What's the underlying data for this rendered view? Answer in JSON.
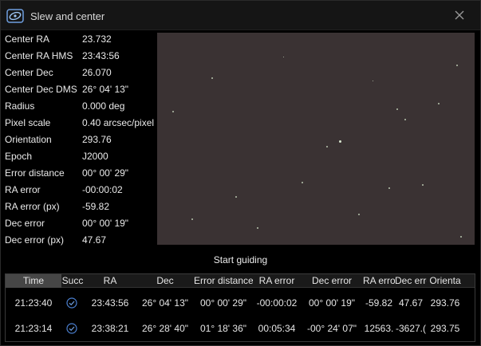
{
  "window": {
    "title": "Slew and center"
  },
  "properties": [
    {
      "key": "Center RA",
      "value": "23.732"
    },
    {
      "key": "Center RA HMS",
      "value": "23:43:56"
    },
    {
      "key": "Center Dec",
      "value": "26.070"
    },
    {
      "key": "Center Dec DMS",
      "value": "26° 04' 13\""
    },
    {
      "key": "Radius",
      "value": "0.000 deg"
    },
    {
      "key": "Pixel scale",
      "value": "0.40 arcsec/pixel"
    },
    {
      "key": "Orientation",
      "value": "293.76"
    },
    {
      "key": "Epoch",
      "value": "J2000"
    },
    {
      "key": "Error distance",
      "value": "00° 00' 29\""
    },
    {
      "key": "RA error",
      "value": "-00:00:02"
    },
    {
      "key": "RA error (px)",
      "value": "-59.82"
    },
    {
      "key": "Dec error",
      "value": "00° 00' 19\""
    },
    {
      "key": "Dec error (px)",
      "value": "47.67"
    }
  ],
  "guide_button": "Start guiding",
  "table": {
    "columns": [
      "Time",
      "Succ",
      "RA",
      "Dec",
      "Error distance",
      "RA error",
      "Dec error",
      "RA erro",
      "Dec erro",
      "Orienta"
    ],
    "rows": [
      {
        "time": "21:23:40",
        "success_icon": "check-circle-icon",
        "ra": "23:43:56",
        "dec": "26° 04' 13\"",
        "error_distance": "00° 00' 29\"",
        "ra_error": "-00:00:02",
        "dec_error": "00° 00' 19\"",
        "ra_error_px": "-59.82",
        "dec_error_px": "47.67",
        "orientation": "293.76"
      },
      {
        "time": "21:23:14",
        "success_icon": "check-circle-icon",
        "ra": "23:38:21",
        "dec": "26° 28' 40\"",
        "error_distance": "01° 18' 36\"",
        "ra_error": "00:05:34",
        "dec_error": "-00° 24' 07\"",
        "ra_error_px": "12563.",
        "dec_error_px": "-3627.(",
        "orientation": "293.75"
      }
    ]
  },
  "colors": {
    "accent": "#4a7fd0",
    "preview_bg": "#3a3233"
  }
}
